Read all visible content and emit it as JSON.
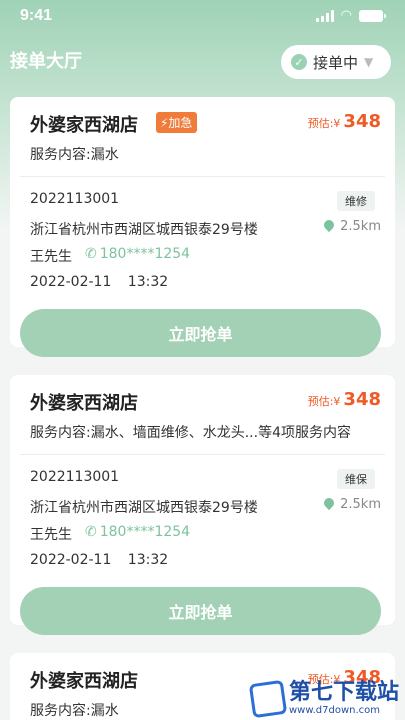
{
  "status_bar": {
    "time": "9:41"
  },
  "header": {
    "title": "接单大厅",
    "status_toggle": {
      "label": "接单中",
      "check_icon": "check-circle-icon",
      "caret_icon": "caret-down-icon"
    }
  },
  "orders": [
    {
      "shop": "外婆家西湖店",
      "urgent_label": "⚡加急",
      "price_label": "预估:¥",
      "price": "348",
      "service": "服务内容:漏水",
      "order_no": "2022113001",
      "type": "维修",
      "address": "浙江省杭州市西湖区城西银泰29号楼",
      "distance": "2.5km",
      "contact": "王先生",
      "phone": "180****1254",
      "datetime": "2022-02-11 13:32",
      "button": "立即抢单"
    },
    {
      "shop": "外婆家西湖店",
      "price_label": "预估:¥",
      "price": "348",
      "service": "服务内容:漏水、墙面维修、水龙头...等4项服务内容",
      "order_no": "2022113001",
      "type": "维保",
      "address": "浙江省杭州市西湖区城西银泰29号楼",
      "distance": "2.5km",
      "contact": "王先生",
      "phone": "180****1254",
      "datetime": "2022-02-11 13:32",
      "button": "立即抢单"
    },
    {
      "shop": "外婆家西湖店",
      "price_label": "预估:¥",
      "price": "348",
      "service": "服务内容:漏水"
    }
  ],
  "watermark": {
    "title": "第七下载站",
    "url": "www.d7down.com"
  },
  "colors": {
    "accent": "#a2d1b5",
    "price": "#f05a24",
    "urgent": "#ef7c3a"
  }
}
